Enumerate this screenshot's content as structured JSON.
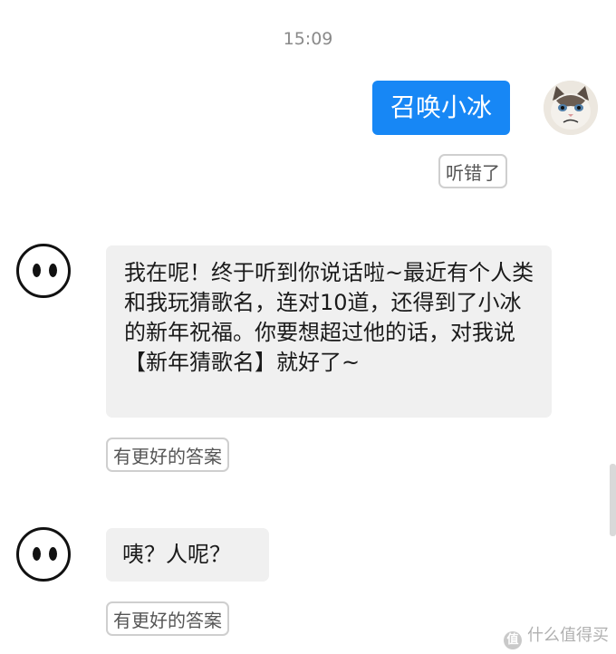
{
  "timestamp": "15:09",
  "user_message": {
    "text": "召唤小冰",
    "avatar_icon": "grumpy-cat-avatar"
  },
  "user_chip": "听错了",
  "bot_messages": [
    {
      "text": "我在呢！终于听到你说话啦~最近有个人类和我玩猜歌名，连对10道，还得到了小冰的新年祝福。你要想超过他的话，对我说【新年猜歌名】就好了~",
      "feedback_chip": "有更好的答案"
    },
    {
      "text": "咦？人呢？",
      "feedback_chip": "有更好的答案"
    }
  ],
  "watermark": {
    "icon_text": "值",
    "text": "什么值得买"
  },
  "colors": {
    "user_bubble": "#1787f5",
    "bot_bubble": "#f0f0f0",
    "chip_border": "#cfcfcf"
  }
}
